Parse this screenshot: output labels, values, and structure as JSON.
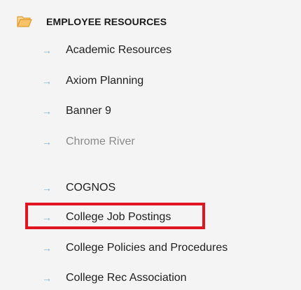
{
  "section": {
    "title": "EMPLOYEE RESOURCES",
    "icon": "folder-open-icon",
    "icon_color": "#f0a830"
  },
  "items": [
    {
      "label": "Academic Resources",
      "icon": "arrow-right-icon"
    },
    {
      "label": "Axiom Planning",
      "icon": "arrow-right-icon"
    },
    {
      "label": "Banner 9",
      "icon": "arrow-right-icon"
    },
    {
      "label": "Chrome River",
      "icon": "arrow-right-icon",
      "state": "dimmed"
    },
    {
      "label": "COGNOS",
      "icon": "arrow-right-icon"
    },
    {
      "label": "College Job Postings",
      "icon": "arrow-right-icon",
      "highlighted": true
    },
    {
      "label": "College Policies and Procedures",
      "icon": "arrow-right-icon"
    },
    {
      "label": "College Rec Association",
      "icon": "arrow-right-icon"
    }
  ],
  "arrow_glyph": "→",
  "colors": {
    "background": "#f4f4f4",
    "arrow": "#7fb4d6",
    "highlight": "#e0151f",
    "text": "#1f1f1f",
    "dimmed_text": "#8a8a8a"
  }
}
